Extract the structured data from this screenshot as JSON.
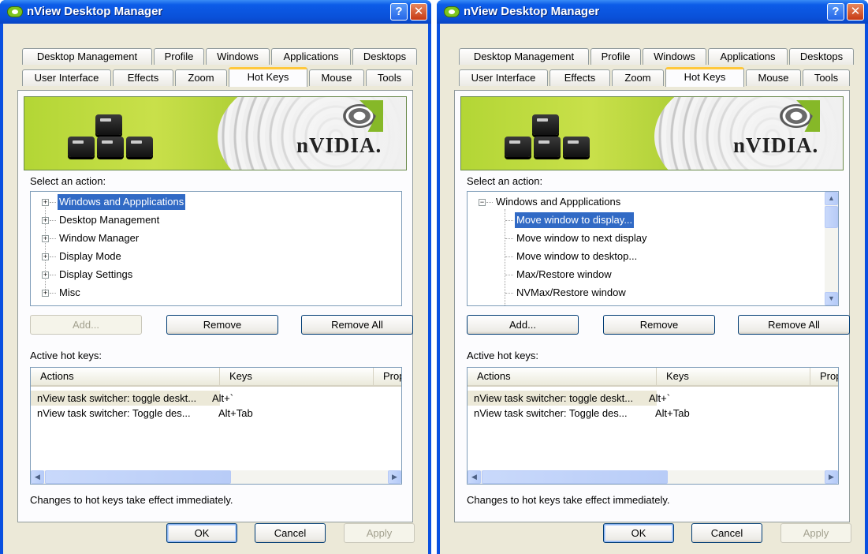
{
  "windows": [
    {
      "title": "nView Desktop Manager",
      "title_buttons": {
        "help": "?",
        "close": "✕"
      },
      "tabs_row1": [
        "Desktop Management",
        "Profile",
        "Windows",
        "Applications",
        "Desktops"
      ],
      "tabs_row2": [
        "User Interface",
        "Effects",
        "Zoom",
        "Hot Keys",
        "Mouse",
        "Tools"
      ],
      "active_tab": "Hot Keys",
      "banner_brand": "nVIDIA.",
      "select_label": "Select an action:",
      "tree": [
        {
          "label": "Windows and Appplications",
          "expander": "+",
          "selected": true
        },
        {
          "label": "Desktop Management",
          "expander": "+"
        },
        {
          "label": "Window Manager",
          "expander": "+"
        },
        {
          "label": "Display Mode",
          "expander": "+"
        },
        {
          "label": "Display Settings",
          "expander": "+"
        },
        {
          "label": "Misc",
          "expander": "+"
        }
      ],
      "buttons": {
        "add": "Add...",
        "remove": "Remove",
        "remove_all": "Remove All",
        "add_disabled": true
      },
      "active_label": "Active hot keys:",
      "columns": [
        "Actions",
        "Keys",
        "Prope"
      ],
      "rows": [
        {
          "action": "nView task switcher: toggle deskt...",
          "keys": "Alt+`"
        },
        {
          "action": "nView task switcher: Toggle des...",
          "keys": "Alt+Tab"
        }
      ],
      "note": "Changes to hot keys take effect immediately.",
      "dialog": {
        "ok": "OK",
        "cancel": "Cancel",
        "apply": "Apply"
      }
    },
    {
      "title": "nView Desktop Manager",
      "title_buttons": {
        "help": "?",
        "close": "✕"
      },
      "tabs_row1": [
        "Desktop Management",
        "Profile",
        "Windows",
        "Applications",
        "Desktops"
      ],
      "tabs_row2": [
        "User Interface",
        "Effects",
        "Zoom",
        "Hot Keys",
        "Mouse",
        "Tools"
      ],
      "active_tab": "Hot Keys",
      "banner_brand": "nVIDIA.",
      "select_label": "Select an action:",
      "tree_root": {
        "label": "Windows and Appplications",
        "expander": "−"
      },
      "tree_children": [
        {
          "label": "Move window to display...",
          "selected": true
        },
        {
          "label": "Move window to next display"
        },
        {
          "label": "Move window to desktop..."
        },
        {
          "label": "Max/Restore window"
        },
        {
          "label": "NVMax/Restore window"
        }
      ],
      "buttons": {
        "add": "Add...",
        "remove": "Remove",
        "remove_all": "Remove All",
        "add_disabled": false
      },
      "active_label": "Active hot keys:",
      "columns": [
        "Actions",
        "Keys",
        "Prope"
      ],
      "rows": [
        {
          "action": "nView task switcher: toggle deskt...",
          "keys": "Alt+`"
        },
        {
          "action": "nView task switcher: Toggle des...",
          "keys": "Alt+Tab"
        }
      ],
      "note": "Changes to hot keys take effect immediately.",
      "dialog": {
        "ok": "OK",
        "cancel": "Cancel",
        "apply": "Apply"
      }
    }
  ],
  "scroll_arrows": {
    "up": "▲",
    "down": "▼",
    "left": "◀",
    "right": "▶"
  },
  "colors": {
    "titlebar": "#0a50e0",
    "selection": "#316ac5",
    "active_tab_accent": "#ffc83c",
    "nvidia_green": "#86b828"
  }
}
